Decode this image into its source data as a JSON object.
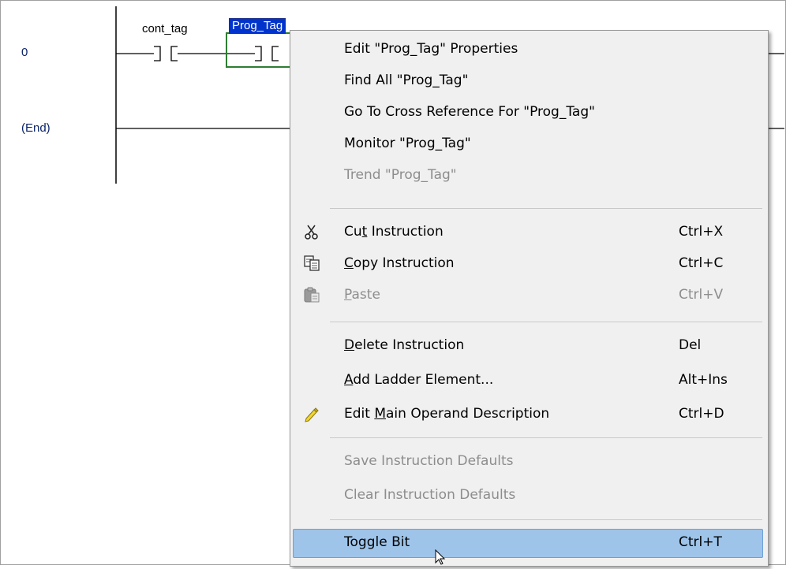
{
  "ladder": {
    "rungs": [
      {
        "number": "0"
      },
      {
        "number": "(End)"
      }
    ],
    "instructions": [
      {
        "tag": "cont_tag"
      },
      {
        "tag": "Prog_Tag"
      }
    ]
  },
  "context_menu": {
    "items": [
      {
        "label": "Edit \"Prog_Tag\" Properties",
        "shortcut": "",
        "enabled": true
      },
      {
        "label": "Find All \"Prog_Tag\"",
        "shortcut": "",
        "enabled": true
      },
      {
        "label": "Go To Cross Reference For \"Prog_Tag\"",
        "shortcut": "",
        "enabled": true
      },
      {
        "label": "Monitor \"Prog_Tag\"",
        "shortcut": "",
        "enabled": true
      },
      {
        "label": "Trend \"Prog_Tag\"",
        "shortcut": "",
        "enabled": false
      },
      {
        "label_pre": "Cu",
        "label_key": "t",
        "label_post": " Instruction",
        "shortcut": "Ctrl+X",
        "icon": "scissors-icon",
        "enabled": true
      },
      {
        "label_pre": "",
        "label_key": "C",
        "label_post": "opy Instruction",
        "shortcut": "Ctrl+C",
        "icon": "copy-icon",
        "enabled": true
      },
      {
        "label_pre": "",
        "label_key": "P",
        "label_post": "aste",
        "shortcut": "Ctrl+V",
        "icon": "paste-icon",
        "enabled": false
      },
      {
        "label_pre": "",
        "label_key": "D",
        "label_post": "elete Instruction",
        "shortcut": "Del",
        "enabled": true
      },
      {
        "label_pre": "",
        "label_key": "A",
        "label_post": "dd Ladder Element...",
        "shortcut": "Alt+Ins",
        "enabled": true
      },
      {
        "label_pre": "Edit ",
        "label_key": "M",
        "label_post": "ain Operand Description",
        "shortcut": "Ctrl+D",
        "icon": "pencil-icon",
        "enabled": true
      },
      {
        "label": "Save Instruction Defaults",
        "shortcut": "",
        "enabled": false
      },
      {
        "label": "Clear Instruction Defaults",
        "shortcut": "",
        "enabled": false
      },
      {
        "label": "Toggle Bit",
        "shortcut": "Ctrl+T",
        "enabled": true,
        "highlighted": true
      }
    ]
  },
  "colors": {
    "selection": "#0033cc",
    "highlight": "#9ec4ea",
    "disabled_text": "#8d8d8d"
  }
}
